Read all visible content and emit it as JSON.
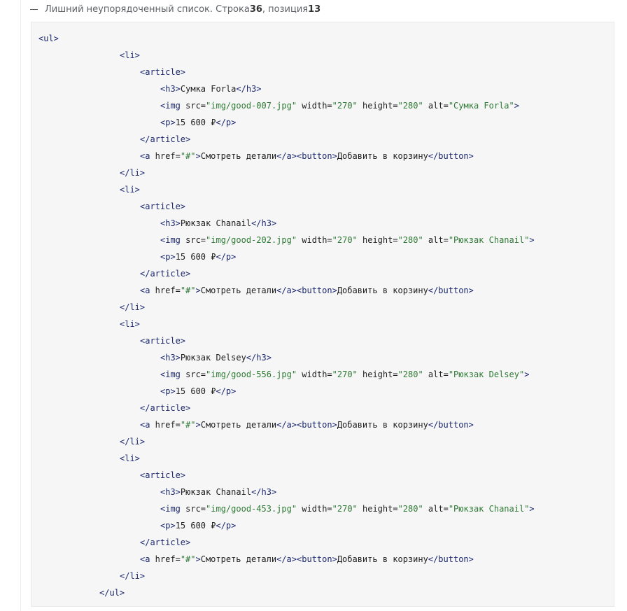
{
  "header": {
    "message": "Лишний неупорядоченный список. Строка ",
    "line_number": "36",
    "separator": ", позиция ",
    "position": "13"
  },
  "code": {
    "ul_open": "<ul>",
    "ul_close": "</ul>",
    "li_open": "<li>",
    "li_close": "</li>",
    "article_open": "<article>",
    "article_close": "</article>",
    "h3_open": "<h3>",
    "h3_close": "</h3>",
    "img_open": "<img",
    "attr_src": " src=",
    "attr_width": " width=",
    "attr_height": " height=",
    "attr_alt": " alt=",
    "tag_end": ">",
    "width_value": "\"270\"",
    "height_value": "\"280\"",
    "p_open": "<p>",
    "p_close": "</p>",
    "a_open": "<a",
    "attr_href": " href=",
    "href_value": "\"#\"",
    "a_text": "Смотреть детали",
    "a_close": "</a>",
    "button_open": "<button>",
    "button_text": "Добавить в корзину",
    "button_close": "</button>",
    "items": [
      {
        "title": "Сумка Forla",
        "src": "\"img/good-007.jpg\"",
        "alt": "\"Сумка Forla\"",
        "price": "15 600 ₽"
      },
      {
        "title": "Рюкзак Chanail",
        "src": "\"img/good-202.jpg\"",
        "alt": "\"Рюкзак Chanail\"",
        "price": "15 600 ₽"
      },
      {
        "title": "Рюкзак Delsey",
        "src": "\"img/good-556.jpg\"",
        "alt": "\"Рюкзак Delsey\"",
        "price": "15 600 ₽"
      },
      {
        "title": "Рюкзак Chanail",
        "src": "\"img/good-453.jpg\"",
        "alt": "\"Рюкзак Chanail\"",
        "price": "15 600 ₽"
      }
    ]
  },
  "colors": {
    "tag": "#1d2a6e",
    "string": "#2f7a34",
    "text": "#1f1f1f",
    "panel_background": "#f6f6f7"
  }
}
